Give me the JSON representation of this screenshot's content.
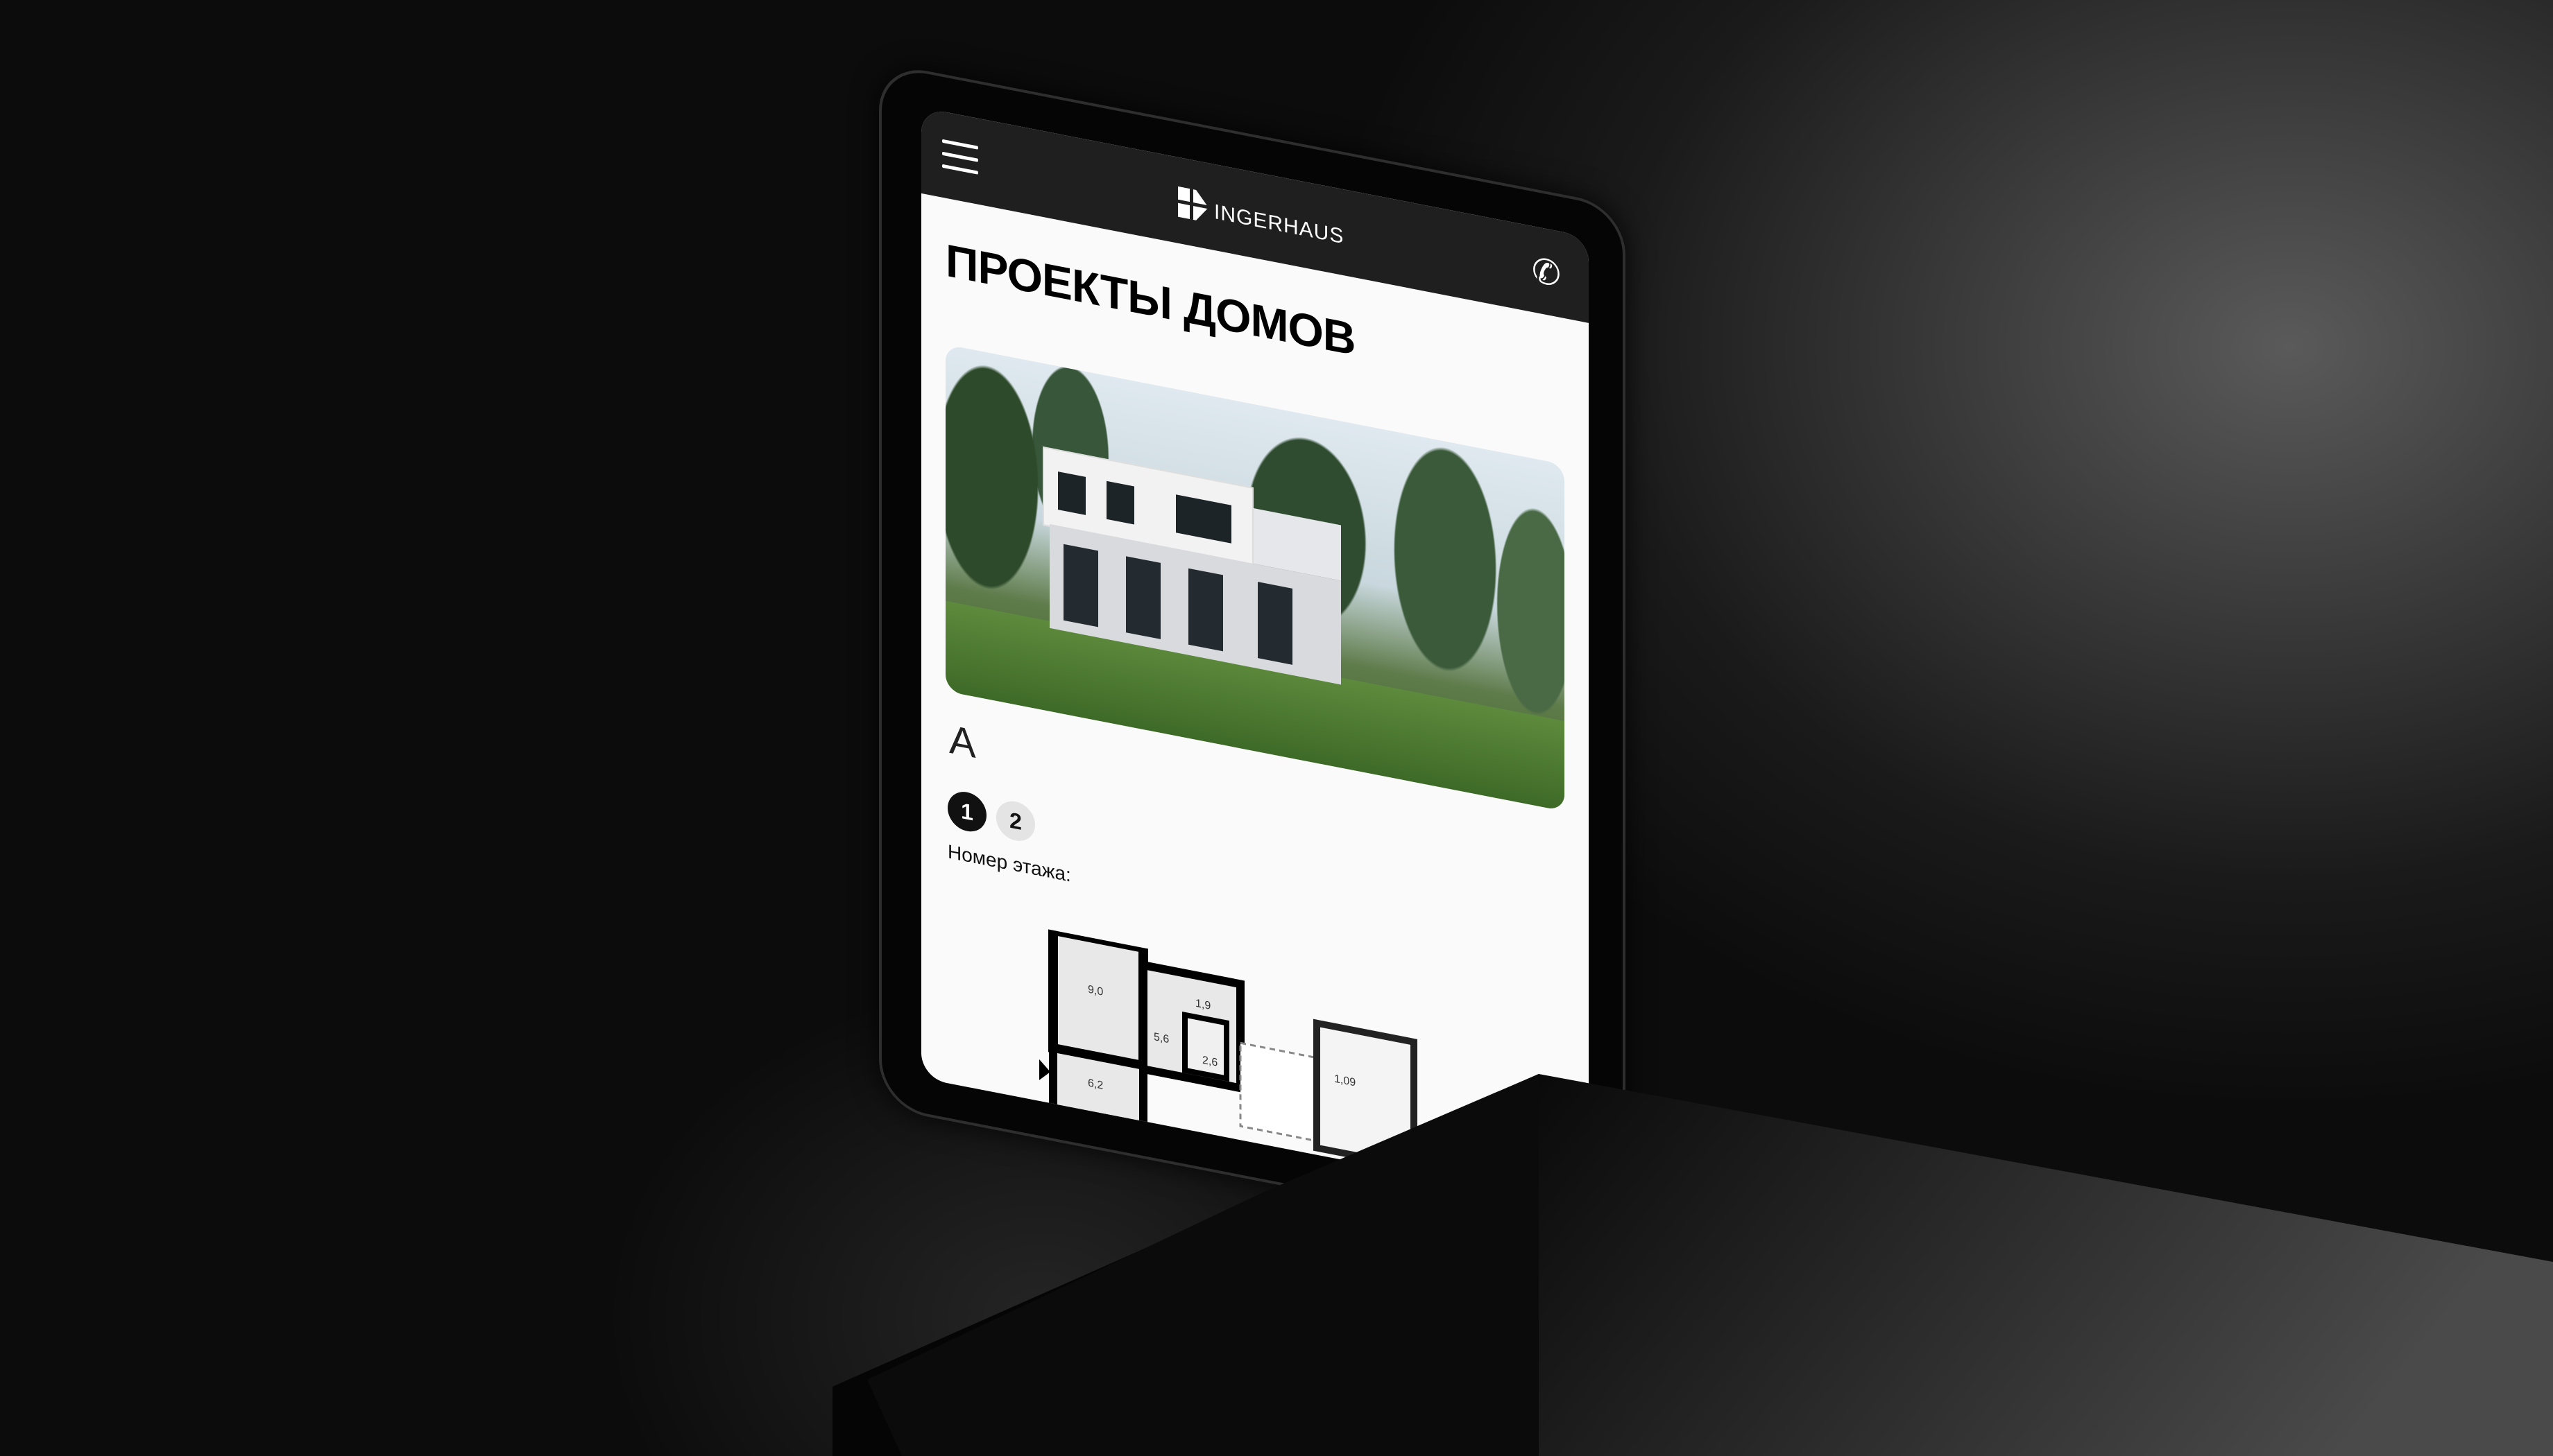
{
  "header": {
    "brand": "INGERHAUS",
    "menu_icon": "hamburger-icon",
    "phone_icon": "phone-icon"
  },
  "page": {
    "title": "ПРОЕКТЫ ДОМОВ",
    "project_name": "А"
  },
  "floor_selector": {
    "label": "Номер этажа:",
    "floors": [
      "1",
      "2"
    ],
    "active": "1"
  },
  "floor_plan": {
    "rooms": [
      "9,0",
      "1,9",
      "5,6",
      "2,6",
      "6,2",
      "1,09"
    ]
  },
  "colors": {
    "header_bg": "#1f1f1f",
    "active_floor": "#111111",
    "idle_floor": "#e4e4e4"
  }
}
